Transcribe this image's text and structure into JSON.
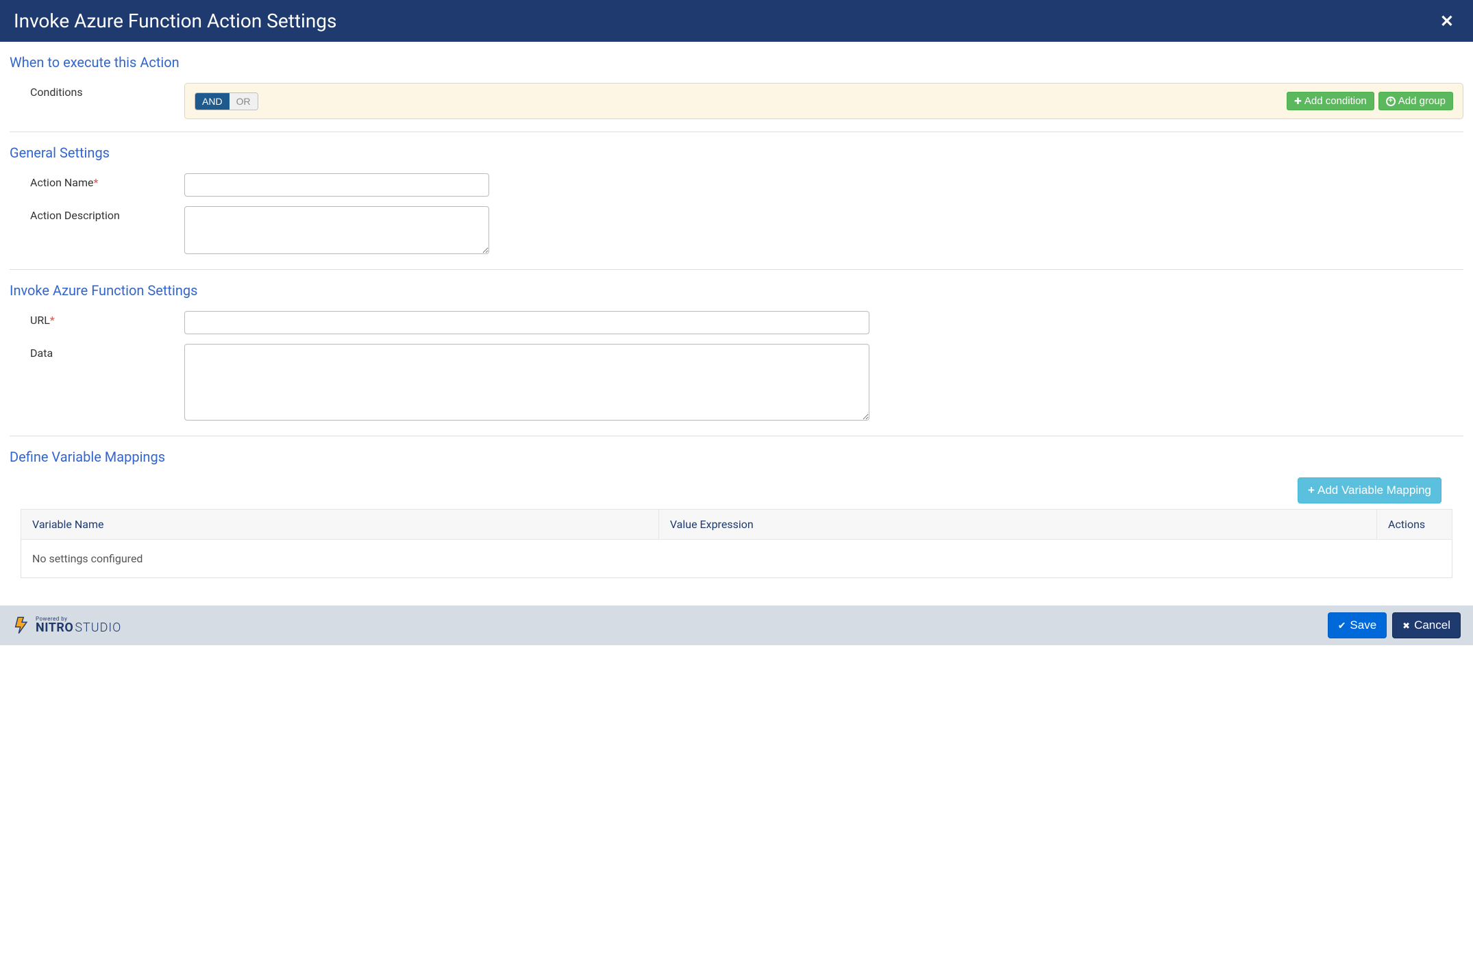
{
  "header": {
    "title": "Invoke Azure Function Action Settings",
    "close_icon": "x"
  },
  "sections": {
    "when": {
      "title": "When to execute this Action",
      "conditions_label": "Conditions",
      "toggle": {
        "and": "AND",
        "or": "OR",
        "active": "AND"
      },
      "add_condition": "Add condition",
      "add_group": "Add group"
    },
    "general": {
      "title": "General Settings",
      "action_name_label": "Action Name",
      "action_name_value": "",
      "action_desc_label": "Action Description",
      "action_desc_value": ""
    },
    "invoke": {
      "title": "Invoke Azure Function Settings",
      "url_label": "URL",
      "url_value": "",
      "data_label": "Data",
      "data_value": ""
    },
    "mappings": {
      "title": "Define Variable Mappings",
      "add_button": "Add Variable Mapping",
      "columns": {
        "name": "Variable Name",
        "expr": "Value Expression",
        "actions": "Actions"
      },
      "empty_message": "No settings configured"
    }
  },
  "footer": {
    "powered_by": "Powered by",
    "brand": "NITRO",
    "studio": "STUDIO",
    "save": "Save",
    "cancel": "Cancel"
  }
}
